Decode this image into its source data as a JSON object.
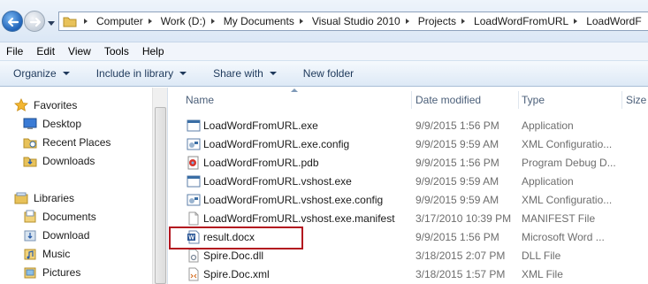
{
  "address_bar": {
    "crumbs": [
      "Computer",
      "Work (D:)",
      "My Documents",
      "Visual Studio 2010",
      "Projects",
      "LoadWordFromURL",
      "LoadWordF"
    ]
  },
  "menu": [
    "File",
    "Edit",
    "View",
    "Tools",
    "Help"
  ],
  "commands": [
    "Organize",
    "Include in library",
    "Share with",
    "New folder"
  ],
  "nav_pane": {
    "favorites": {
      "label": "Favorites",
      "items": [
        "Desktop",
        "Recent Places",
        "Downloads"
      ]
    },
    "libraries": {
      "label": "Libraries",
      "items": [
        "Documents",
        "Download",
        "Music",
        "Pictures"
      ]
    }
  },
  "columns": {
    "name": "Name",
    "date": "Date modified",
    "type": "Type",
    "size": "Size"
  },
  "files": [
    {
      "name": "LoadWordFromURL.exe",
      "date": "9/9/2015 1:56 PM",
      "type": "Application",
      "icon": "exe-icon"
    },
    {
      "name": "LoadWordFromURL.exe.config",
      "date": "9/9/2015 9:59 AM",
      "type": "XML Configuratio...",
      "icon": "config-icon"
    },
    {
      "name": "LoadWordFromURL.pdb",
      "date": "9/9/2015 1:56 PM",
      "type": "Program Debug D...",
      "icon": "pdb-icon"
    },
    {
      "name": "LoadWordFromURL.vshost.exe",
      "date": "9/9/2015 9:59 AM",
      "type": "Application",
      "icon": "exe-icon"
    },
    {
      "name": "LoadWordFromURL.vshost.exe.config",
      "date": "9/9/2015 9:59 AM",
      "type": "XML Configuratio...",
      "icon": "config-icon"
    },
    {
      "name": "LoadWordFromURL.vshost.exe.manifest",
      "date": "3/17/2010 10:39 PM",
      "type": "MANIFEST File",
      "icon": "blank-file-icon"
    },
    {
      "name": "result.docx",
      "date": "9/9/2015 1:56 PM",
      "type": "Microsoft Word ...",
      "icon": "word-doc-icon",
      "highlighted": true
    },
    {
      "name": "Spire.Doc.dll",
      "date": "3/18/2015 2:07 PM",
      "type": "DLL File",
      "icon": "dll-icon"
    },
    {
      "name": "Spire.Doc.xml",
      "date": "3/18/2015 1:57 PM",
      "type": "XML File",
      "icon": "xml-icon"
    }
  ],
  "colors": {
    "highlight_border": "#b3161f",
    "toolbar_bg": "#dde9f6"
  }
}
